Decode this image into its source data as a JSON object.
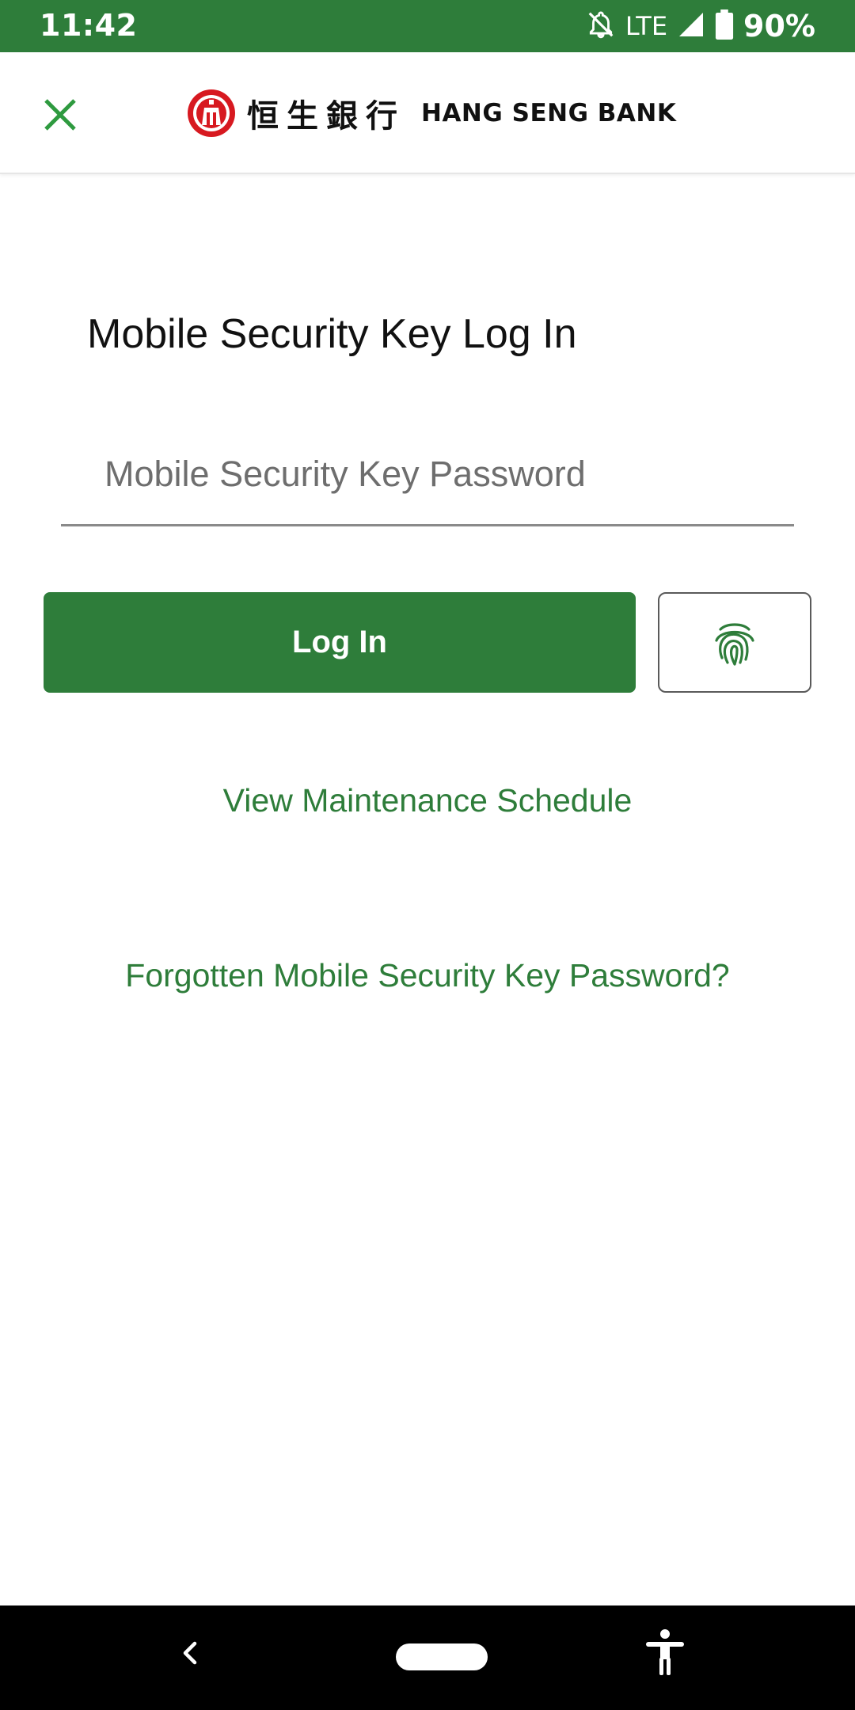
{
  "status_bar": {
    "time": "11:42",
    "network": "LTE",
    "battery": "90%"
  },
  "header": {
    "brand_chinese": "恒生銀行",
    "brand_english": "HANG SENG BANK"
  },
  "main": {
    "title": "Mobile Security Key Log In",
    "password_placeholder": "Mobile Security Key Password",
    "password_value": "",
    "login_label": "Log In",
    "maintenance_link": "View Maintenance Schedule",
    "forgot_link": "Forgotten Mobile Security Key Password?"
  },
  "colors": {
    "accent": "#2e7d3a",
    "logo_red": "#d71920"
  },
  "icons": {
    "close": "close-icon",
    "fingerprint": "fingerprint-icon",
    "logo": "hang-seng-logo",
    "back": "back-icon",
    "home": "home-pill",
    "accessibility": "accessibility-icon"
  }
}
